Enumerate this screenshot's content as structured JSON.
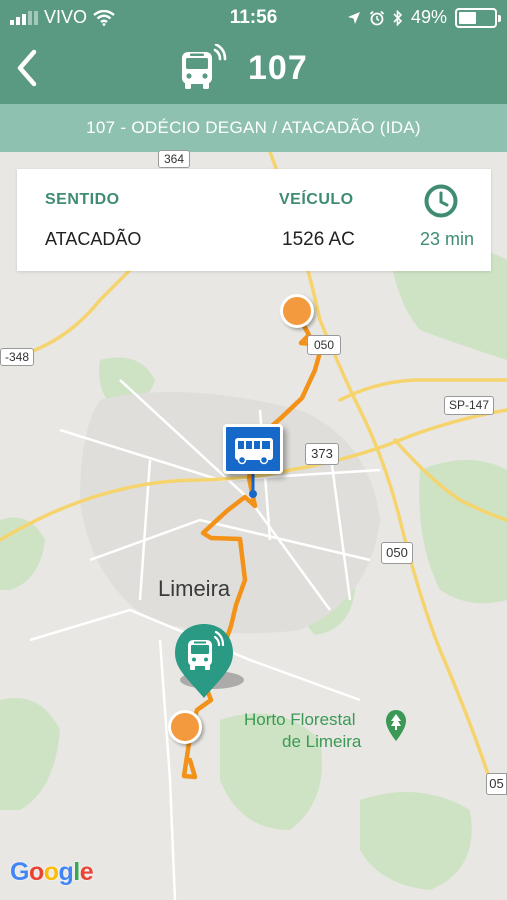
{
  "status_bar": {
    "carrier": "VIVO",
    "time": "11:56",
    "battery": "49%"
  },
  "header": {
    "route_number": "107",
    "subtitle": "107 - ODÉCIO DEGAN / ATACADÃO (IDA)"
  },
  "info_card": {
    "direction_label": "SENTIDO",
    "direction_value": "ATACADÃO",
    "vehicle_label": "VEÍCULO",
    "vehicle_value": "1526 AC",
    "eta": "23 min"
  },
  "map": {
    "city_label": "Limeira",
    "poi_line1": "Horto Florestal",
    "poi_line2": "de Limeira",
    "shields": [
      "364",
      "050",
      "-348",
      "SP-147",
      "373",
      "050",
      "05"
    ],
    "attribution": "Google",
    "colors": {
      "route": "#f39219",
      "stop_marker": "#f39a3e",
      "vehicle_marker": "#1769c9",
      "pin": "#2b9a85",
      "poi_text": "#3a9a55",
      "primary": "#5a9a83"
    }
  }
}
